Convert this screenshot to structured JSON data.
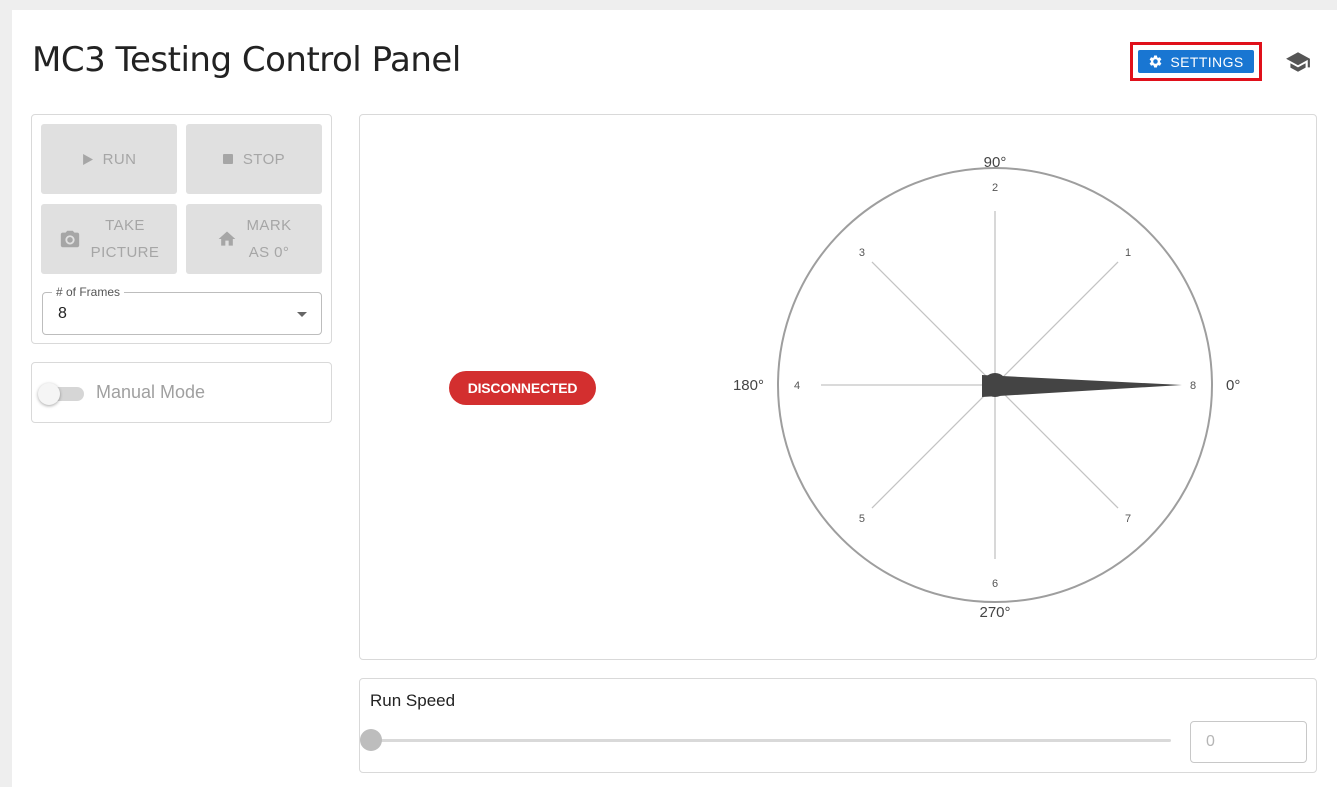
{
  "header": {
    "title": "MC3 Testing Control Panel",
    "settings_label": "SETTINGS"
  },
  "controls": {
    "run_label": "RUN",
    "stop_label": "STOP",
    "take_picture": [
      "TAKE",
      "PICTURE"
    ],
    "mark_zero": [
      "MARK",
      "AS 0°"
    ],
    "frames": {
      "label": "# of Frames",
      "value": "8"
    }
  },
  "manual_mode": {
    "label": "Manual Mode",
    "enabled": false
  },
  "status": {
    "label": "DISCONNECTED",
    "color": "#d32f2f"
  },
  "dial": {
    "angle_labels": [
      "0°",
      "90°",
      "180°",
      "270°"
    ],
    "frame_count": 8,
    "pointer_angle_deg": 0
  },
  "run_speed": {
    "label": "Run Speed",
    "value": 0,
    "input_value": "0"
  },
  "colors": {
    "accent": "#1976d2",
    "highlight_outline": "#e0101a",
    "disabled_button": "#e0e0e0"
  },
  "icons": {
    "settings": "gear-icon",
    "school": "graduation-cap-icon",
    "run": "play-icon",
    "stop": "stop-icon",
    "picture": "camera-icon",
    "mark": "home-icon"
  }
}
